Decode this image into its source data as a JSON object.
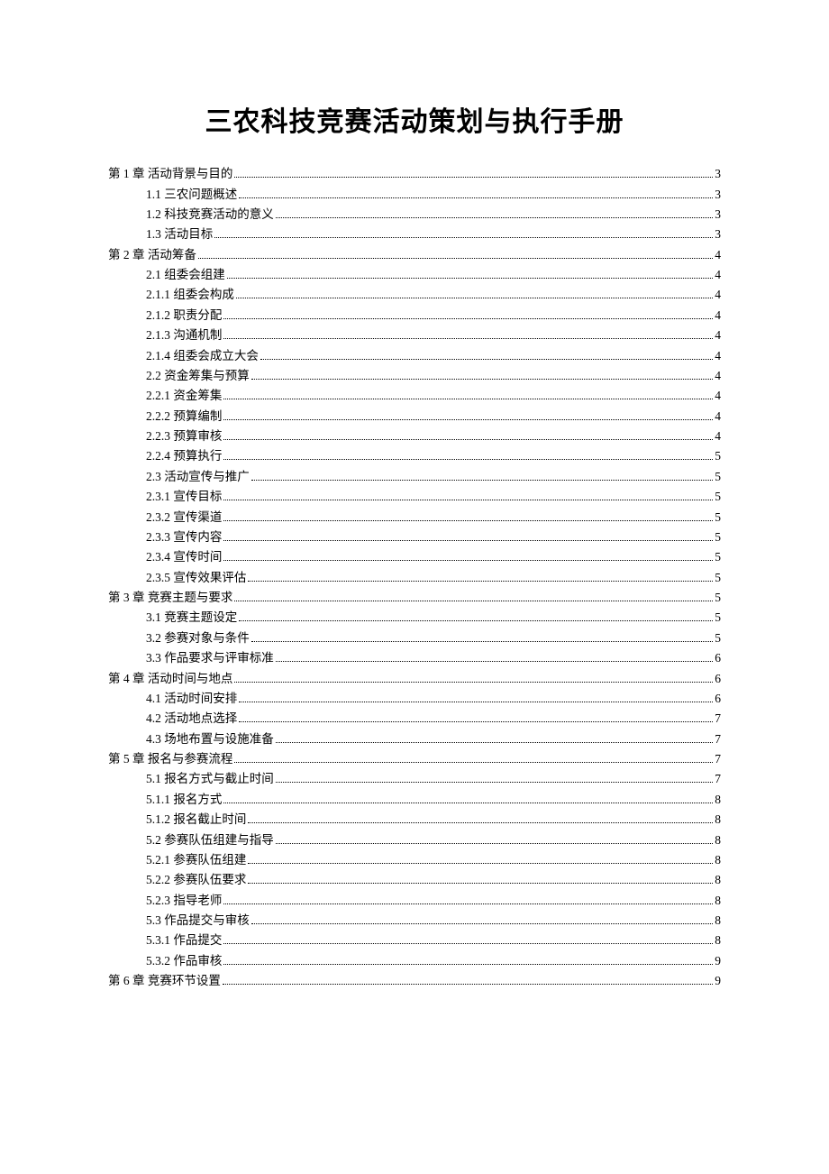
{
  "title": "三农科技竞赛活动策划与执行手册",
  "toc": [
    {
      "level": 1,
      "label": "第 1 章 活动背景与目的",
      "page": "3"
    },
    {
      "level": 2,
      "label": "1.1 三农问题概述",
      "page": "3"
    },
    {
      "level": 2,
      "label": "1.2 科技竞赛活动的意义",
      "page": "3"
    },
    {
      "level": 2,
      "label": "1.3 活动目标",
      "page": "3"
    },
    {
      "level": 1,
      "label": "第 2 章 活动筹备",
      "page": "4"
    },
    {
      "level": 2,
      "label": "2.1 组委会组建",
      "page": "4"
    },
    {
      "level": 2,
      "label": "2.1.1 组委会构成",
      "page": "4"
    },
    {
      "level": 2,
      "label": "2.1.2 职责分配",
      "page": "4"
    },
    {
      "level": 2,
      "label": "2.1.3 沟通机制",
      "page": "4"
    },
    {
      "level": 2,
      "label": "2.1.4 组委会成立大会",
      "page": "4"
    },
    {
      "level": 2,
      "label": "2.2 资金筹集与预算",
      "page": "4"
    },
    {
      "level": 2,
      "label": "2.2.1 资金筹集",
      "page": "4"
    },
    {
      "level": 2,
      "label": "2.2.2 预算编制",
      "page": "4"
    },
    {
      "level": 2,
      "label": "2.2.3 预算审核",
      "page": "4"
    },
    {
      "level": 2,
      "label": "2.2.4 预算执行",
      "page": "5"
    },
    {
      "level": 2,
      "label": "2.3 活动宣传与推广",
      "page": "5"
    },
    {
      "level": 2,
      "label": "2.3.1 宣传目标",
      "page": "5"
    },
    {
      "level": 2,
      "label": "2.3.2 宣传渠道",
      "page": "5"
    },
    {
      "level": 2,
      "label": "2.3.3 宣传内容",
      "page": "5"
    },
    {
      "level": 2,
      "label": "2.3.4 宣传时间",
      "page": "5"
    },
    {
      "level": 2,
      "label": "2.3.5 宣传效果评估",
      "page": "5"
    },
    {
      "level": 1,
      "label": "第 3 章 竞赛主题与要求",
      "page": "5"
    },
    {
      "level": 2,
      "label": "3.1 竞赛主题设定",
      "page": "5"
    },
    {
      "level": 2,
      "label": "3.2 参赛对象与条件",
      "page": "5"
    },
    {
      "level": 2,
      "label": "3.3 作品要求与评审标准",
      "page": "6"
    },
    {
      "level": 1,
      "label": "第 4 章 活动时间与地点",
      "page": "6"
    },
    {
      "level": 2,
      "label": "4.1 活动时间安排",
      "page": "6"
    },
    {
      "level": 2,
      "label": "4.2 活动地点选择",
      "page": "7"
    },
    {
      "level": 2,
      "label": "4.3 场地布置与设施准备",
      "page": "7"
    },
    {
      "level": 1,
      "label": "第 5 章 报名与参赛流程",
      "page": "7"
    },
    {
      "level": 2,
      "label": "5.1 报名方式与截止时间",
      "page": "7"
    },
    {
      "level": 2,
      "label": "5.1.1 报名方式",
      "page": "8"
    },
    {
      "level": 2,
      "label": "5.1.2 报名截止时间",
      "page": "8"
    },
    {
      "level": 2,
      "label": "5.2 参赛队伍组建与指导",
      "page": "8"
    },
    {
      "level": 2,
      "label": "5.2.1 参赛队伍组建",
      "page": "8"
    },
    {
      "level": 2,
      "label": "5.2.2 参赛队伍要求",
      "page": "8"
    },
    {
      "level": 2,
      "label": "5.2.3 指导老师",
      "page": "8"
    },
    {
      "level": 2,
      "label": "5.3 作品提交与审核",
      "page": "8"
    },
    {
      "level": 2,
      "label": "5.3.1 作品提交",
      "page": "8"
    },
    {
      "level": 2,
      "label": "5.3.2 作品审核",
      "page": "9"
    },
    {
      "level": 1,
      "label": "第 6 章 竞赛环节设置",
      "page": "9"
    }
  ]
}
